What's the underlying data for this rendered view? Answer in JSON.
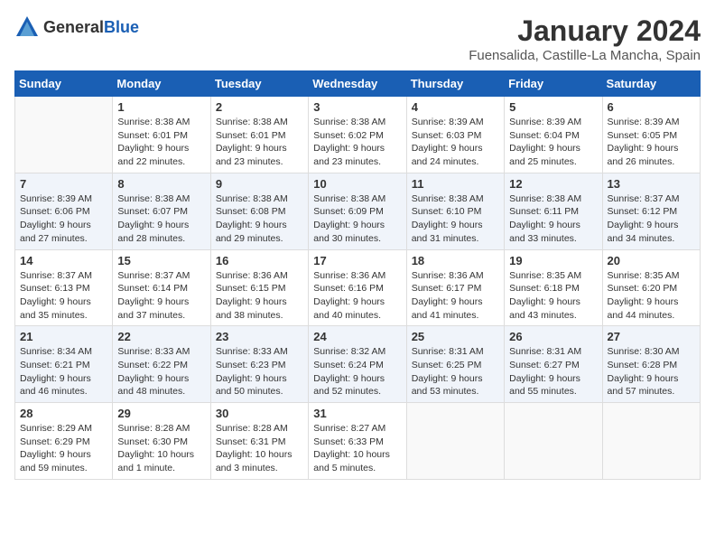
{
  "logo": {
    "general": "General",
    "blue": "Blue"
  },
  "title": "January 2024",
  "location": "Fuensalida, Castille-La Mancha, Spain",
  "weekdays": [
    "Sunday",
    "Monday",
    "Tuesday",
    "Wednesday",
    "Thursday",
    "Friday",
    "Saturday"
  ],
  "weeks": [
    [
      {
        "day": "",
        "sunrise": "",
        "sunset": "",
        "daylight": ""
      },
      {
        "day": "1",
        "sunrise": "Sunrise: 8:38 AM",
        "sunset": "Sunset: 6:01 PM",
        "daylight": "Daylight: 9 hours and 22 minutes."
      },
      {
        "day": "2",
        "sunrise": "Sunrise: 8:38 AM",
        "sunset": "Sunset: 6:01 PM",
        "daylight": "Daylight: 9 hours and 23 minutes."
      },
      {
        "day": "3",
        "sunrise": "Sunrise: 8:38 AM",
        "sunset": "Sunset: 6:02 PM",
        "daylight": "Daylight: 9 hours and 23 minutes."
      },
      {
        "day": "4",
        "sunrise": "Sunrise: 8:39 AM",
        "sunset": "Sunset: 6:03 PM",
        "daylight": "Daylight: 9 hours and 24 minutes."
      },
      {
        "day": "5",
        "sunrise": "Sunrise: 8:39 AM",
        "sunset": "Sunset: 6:04 PM",
        "daylight": "Daylight: 9 hours and 25 minutes."
      },
      {
        "day": "6",
        "sunrise": "Sunrise: 8:39 AM",
        "sunset": "Sunset: 6:05 PM",
        "daylight": "Daylight: 9 hours and 26 minutes."
      }
    ],
    [
      {
        "day": "7",
        "sunrise": "Sunrise: 8:39 AM",
        "sunset": "Sunset: 6:06 PM",
        "daylight": "Daylight: 9 hours and 27 minutes."
      },
      {
        "day": "8",
        "sunrise": "Sunrise: 8:38 AM",
        "sunset": "Sunset: 6:07 PM",
        "daylight": "Daylight: 9 hours and 28 minutes."
      },
      {
        "day": "9",
        "sunrise": "Sunrise: 8:38 AM",
        "sunset": "Sunset: 6:08 PM",
        "daylight": "Daylight: 9 hours and 29 minutes."
      },
      {
        "day": "10",
        "sunrise": "Sunrise: 8:38 AM",
        "sunset": "Sunset: 6:09 PM",
        "daylight": "Daylight: 9 hours and 30 minutes."
      },
      {
        "day": "11",
        "sunrise": "Sunrise: 8:38 AM",
        "sunset": "Sunset: 6:10 PM",
        "daylight": "Daylight: 9 hours and 31 minutes."
      },
      {
        "day": "12",
        "sunrise": "Sunrise: 8:38 AM",
        "sunset": "Sunset: 6:11 PM",
        "daylight": "Daylight: 9 hours and 33 minutes."
      },
      {
        "day": "13",
        "sunrise": "Sunrise: 8:37 AM",
        "sunset": "Sunset: 6:12 PM",
        "daylight": "Daylight: 9 hours and 34 minutes."
      }
    ],
    [
      {
        "day": "14",
        "sunrise": "Sunrise: 8:37 AM",
        "sunset": "Sunset: 6:13 PM",
        "daylight": "Daylight: 9 hours and 35 minutes."
      },
      {
        "day": "15",
        "sunrise": "Sunrise: 8:37 AM",
        "sunset": "Sunset: 6:14 PM",
        "daylight": "Daylight: 9 hours and 37 minutes."
      },
      {
        "day": "16",
        "sunrise": "Sunrise: 8:36 AM",
        "sunset": "Sunset: 6:15 PM",
        "daylight": "Daylight: 9 hours and 38 minutes."
      },
      {
        "day": "17",
        "sunrise": "Sunrise: 8:36 AM",
        "sunset": "Sunset: 6:16 PM",
        "daylight": "Daylight: 9 hours and 40 minutes."
      },
      {
        "day": "18",
        "sunrise": "Sunrise: 8:36 AM",
        "sunset": "Sunset: 6:17 PM",
        "daylight": "Daylight: 9 hours and 41 minutes."
      },
      {
        "day": "19",
        "sunrise": "Sunrise: 8:35 AM",
        "sunset": "Sunset: 6:18 PM",
        "daylight": "Daylight: 9 hours and 43 minutes."
      },
      {
        "day": "20",
        "sunrise": "Sunrise: 8:35 AM",
        "sunset": "Sunset: 6:20 PM",
        "daylight": "Daylight: 9 hours and 44 minutes."
      }
    ],
    [
      {
        "day": "21",
        "sunrise": "Sunrise: 8:34 AM",
        "sunset": "Sunset: 6:21 PM",
        "daylight": "Daylight: 9 hours and 46 minutes."
      },
      {
        "day": "22",
        "sunrise": "Sunrise: 8:33 AM",
        "sunset": "Sunset: 6:22 PM",
        "daylight": "Daylight: 9 hours and 48 minutes."
      },
      {
        "day": "23",
        "sunrise": "Sunrise: 8:33 AM",
        "sunset": "Sunset: 6:23 PM",
        "daylight": "Daylight: 9 hours and 50 minutes."
      },
      {
        "day": "24",
        "sunrise": "Sunrise: 8:32 AM",
        "sunset": "Sunset: 6:24 PM",
        "daylight": "Daylight: 9 hours and 52 minutes."
      },
      {
        "day": "25",
        "sunrise": "Sunrise: 8:31 AM",
        "sunset": "Sunset: 6:25 PM",
        "daylight": "Daylight: 9 hours and 53 minutes."
      },
      {
        "day": "26",
        "sunrise": "Sunrise: 8:31 AM",
        "sunset": "Sunset: 6:27 PM",
        "daylight": "Daylight: 9 hours and 55 minutes."
      },
      {
        "day": "27",
        "sunrise": "Sunrise: 8:30 AM",
        "sunset": "Sunset: 6:28 PM",
        "daylight": "Daylight: 9 hours and 57 minutes."
      }
    ],
    [
      {
        "day": "28",
        "sunrise": "Sunrise: 8:29 AM",
        "sunset": "Sunset: 6:29 PM",
        "daylight": "Daylight: 9 hours and 59 minutes."
      },
      {
        "day": "29",
        "sunrise": "Sunrise: 8:28 AM",
        "sunset": "Sunset: 6:30 PM",
        "daylight": "Daylight: 10 hours and 1 minute."
      },
      {
        "day": "30",
        "sunrise": "Sunrise: 8:28 AM",
        "sunset": "Sunset: 6:31 PM",
        "daylight": "Daylight: 10 hours and 3 minutes."
      },
      {
        "day": "31",
        "sunrise": "Sunrise: 8:27 AM",
        "sunset": "Sunset: 6:33 PM",
        "daylight": "Daylight: 10 hours and 5 minutes."
      },
      {
        "day": "",
        "sunrise": "",
        "sunset": "",
        "daylight": ""
      },
      {
        "day": "",
        "sunrise": "",
        "sunset": "",
        "daylight": ""
      },
      {
        "day": "",
        "sunrise": "",
        "sunset": "",
        "daylight": ""
      }
    ]
  ],
  "row_shading": [
    false,
    true,
    false,
    true,
    false
  ]
}
